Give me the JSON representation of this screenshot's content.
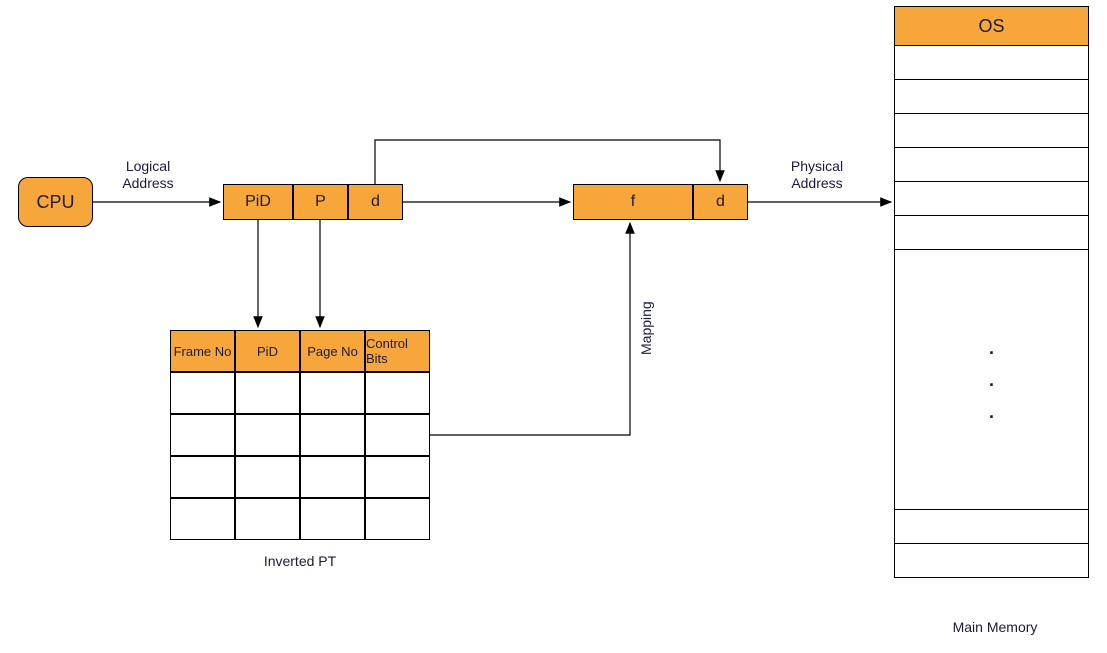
{
  "cpu": {
    "label": "CPU"
  },
  "labels": {
    "logical_address": "Logical\nAddress",
    "physical_address": "Physical\nAddress",
    "mapping": "Mapping",
    "inverted_pt": "Inverted PT",
    "main_memory": "Main Memory"
  },
  "logical_addr": {
    "fields": [
      "PiD",
      "P",
      "d"
    ]
  },
  "physical_addr": {
    "fields": [
      "f",
      "d"
    ]
  },
  "ipt": {
    "headers": [
      "Frame No",
      "PiD",
      "Page No",
      "Control Bits"
    ],
    "rows": 4
  },
  "memory": {
    "header": "OS",
    "top_rows": 6,
    "bottom_rows": 2
  },
  "colors": {
    "accent": "#f7a63c"
  }
}
